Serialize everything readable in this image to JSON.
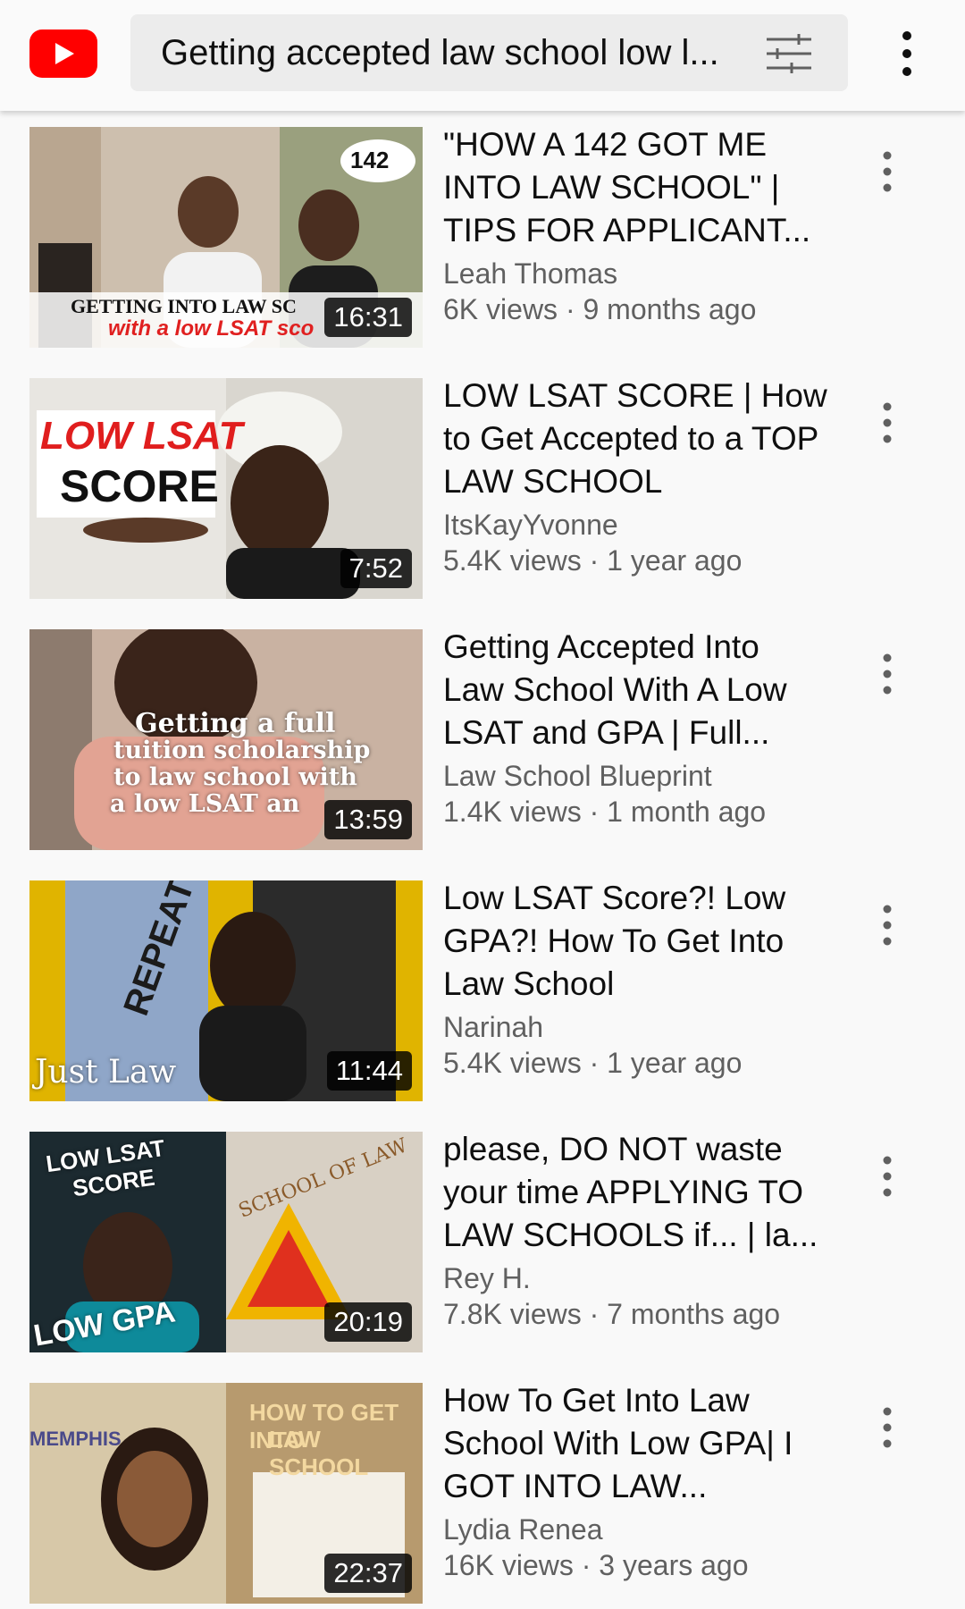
{
  "header": {
    "search_query": "Getting accepted law school low l...",
    "logo_icon": "youtube-logo-icon",
    "filter_icon": "tune-filter-icon",
    "menu_icon": "vertical-more-icon"
  },
  "colors": {
    "brand_red": "#ff0000",
    "text_primary": "#0f0f0f",
    "text_secondary": "#606060"
  },
  "results": [
    {
      "title": "\"HOW A 142 GOT ME INTO LAW SCHOOL\" | TIPS FOR APPLICANT...",
      "channel": "Leah Thomas",
      "stats": "6K views · 9 months ago",
      "duration": "16:31",
      "overlay": [
        "142",
        "GETTING INTO LAW SC",
        "with a low LSAT sco"
      ]
    },
    {
      "title": "LOW LSAT SCORE | How to Get Accepted to a TOP LAW SCHOOL",
      "channel": "ItsKayYvonne",
      "stats": "5.4K views · 1 year ago",
      "duration": "7:52",
      "overlay": [
        "LOW LSAT",
        "SCORE"
      ]
    },
    {
      "title": "Getting Accepted Into Law School With A Low LSAT and GPA | Full...",
      "channel": "Law School Blueprint",
      "stats": "1.4K views · 1 month ago",
      "duration": "13:59",
      "overlay": [
        "Getting a full",
        "tuition scholarship",
        "to law school with",
        "a low LSAT an"
      ]
    },
    {
      "title": "Low LSAT Score?! Low GPA?! How To Get Into Law School",
      "channel": "Narinah",
      "stats": "5.4K views · 1 year ago",
      "duration": "11:44",
      "overlay": [
        "Just Law",
        "REPEAT"
      ]
    },
    {
      "title": "please, DO NOT waste your time APPLYING TO LAW SCHOOLS if... | la...",
      "channel": "Rey H.",
      "stats": "7.8K views · 7 months ago",
      "duration": "20:19",
      "overlay": [
        "LOW LSAT",
        "SCORE",
        "LOW GPA",
        "SCHOOL OF LAW"
      ]
    },
    {
      "title": "How To Get Into Law School With Low GPA| I GOT INTO LAW...",
      "channel": "Lydia Renea",
      "stats": "16K views · 3 years ago",
      "duration": "22:37",
      "overlay": [
        "HOW TO GET INTO",
        "LAW SCHOOL",
        "MEMPHIS"
      ]
    }
  ]
}
